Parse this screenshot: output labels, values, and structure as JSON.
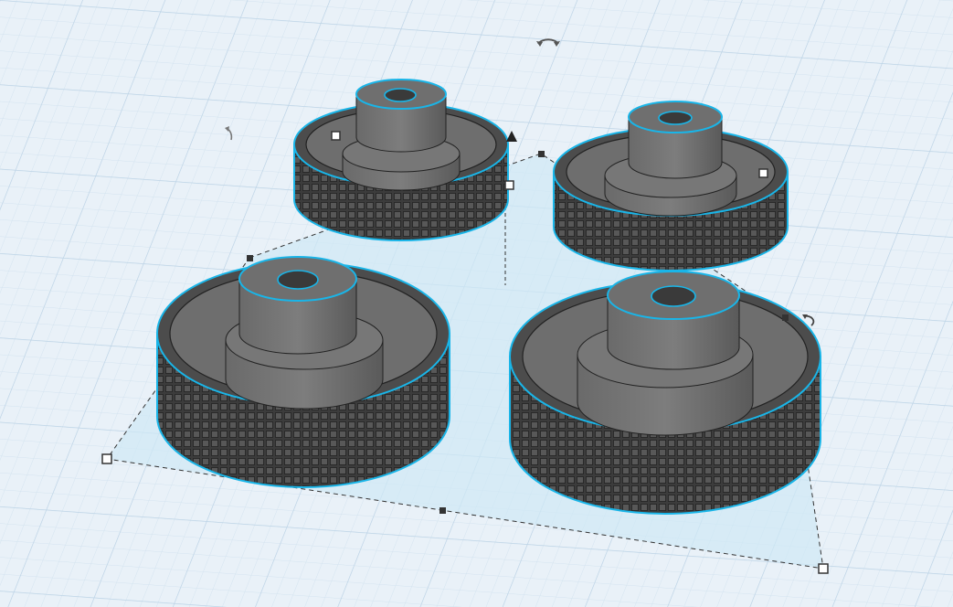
{
  "app": {
    "view": "3d-workplane",
    "accent_color": "#19b5e8",
    "selection_fill_color": "#cfe8f5",
    "shape_color": "#5e5e5e",
    "grid_color": "#c9ddec"
  },
  "scene": {
    "objects": [
      {
        "name": "wheel-back-left",
        "type": "tire-wheel",
        "selected": true
      },
      {
        "name": "wheel-back-right",
        "type": "tire-wheel",
        "selected": true
      },
      {
        "name": "wheel-front-left",
        "type": "tire-wheel",
        "selected": true
      },
      {
        "name": "wheel-front-right",
        "type": "tire-wheel",
        "selected": true
      }
    ],
    "selection_count": 4
  },
  "icons": {
    "rotate_top": "rotate-arc-icon",
    "rotate_left": "rotate-arc-icon",
    "rotate_right": "rotate-arc-icon",
    "height_arrow": "triangle-up-icon"
  }
}
